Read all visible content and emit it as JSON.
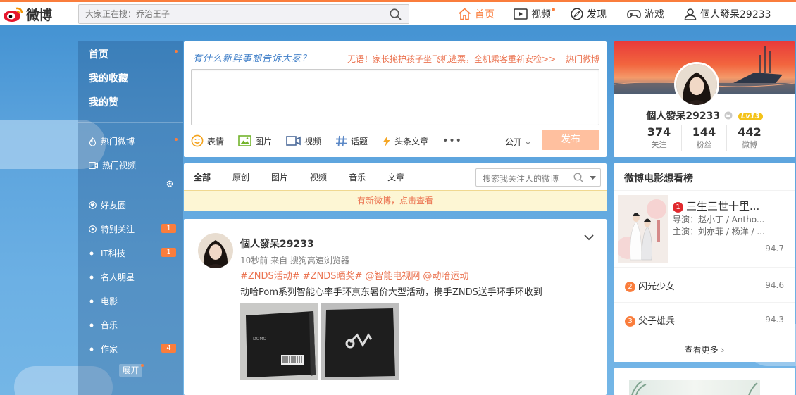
{
  "colors": {
    "accent": "#fa7d3c",
    "link": "#eb7350",
    "brand_blue": "#3e7ec8",
    "publish_disabled": "#ffc09f"
  },
  "header": {
    "logo_text": "微博",
    "search_placeholder": "大家正在搜：乔治王子",
    "nav": [
      {
        "label": "首页",
        "icon": "home-icon",
        "active": true
      },
      {
        "label": "视频",
        "icon": "video-icon",
        "dot": true
      },
      {
        "label": "发现",
        "icon": "compass-icon"
      },
      {
        "label": "游戏",
        "icon": "gamepad-icon"
      },
      {
        "label": "個人發呆29233",
        "icon": "user-icon"
      }
    ]
  },
  "sidebar": {
    "main": [
      "首页",
      "我的收藏",
      "我的赞"
    ],
    "hot": [
      {
        "label": "热门微博",
        "icon": "fire-icon"
      },
      {
        "label": "热门视频",
        "icon": "video-icon"
      }
    ],
    "groups": [
      {
        "label": "好友圈",
        "icon": "heart-icon"
      },
      {
        "label": "特别关注",
        "icon": "target-icon",
        "badge": "1"
      },
      {
        "label": "IT科技",
        "icon": "dot-icon",
        "badge": "1"
      },
      {
        "label": "名人明星",
        "icon": "dot-icon"
      },
      {
        "label": "电影",
        "icon": "dot-icon"
      },
      {
        "label": "音乐",
        "icon": "dot-icon"
      },
      {
        "label": "作家",
        "icon": "dot-icon",
        "badge": "4"
      }
    ],
    "expand_label": "展开"
  },
  "composer": {
    "prompt": "有什么新鲜事想告诉大家？",
    "hot_headline": "无语！家长掩护孩子坐飞机逃票，全机乘客重新安检>>",
    "hot_link": "热门微博",
    "tools": [
      "表情",
      "图片",
      "视频",
      "话题",
      "头条文章"
    ],
    "visibility": "公开",
    "publish": "发布"
  },
  "feed_filter": {
    "tabs": [
      "全部",
      "原创",
      "图片",
      "视频",
      "音乐",
      "文章"
    ],
    "search_placeholder": "搜索我关注人的微博",
    "new_notice": "有新微博，点击查看"
  },
  "post": {
    "author": "個人發呆29233",
    "meta": "10秒前 来自 搜狗高速浏览器",
    "tags": [
      "#ZNDS活动#",
      "#ZNDS晒奖#",
      "@智能电视网",
      "@动哈运动"
    ],
    "text": "动哈Pom系列智能心率手环京东暑价大型活动，携手ZNDS送手环手环收到"
  },
  "profile": {
    "name": "個人發呆29233",
    "level": "Lv13",
    "stats": [
      {
        "value": "374",
        "label": "关注"
      },
      {
        "value": "144",
        "label": "粉丝"
      },
      {
        "value": "442",
        "label": "微博"
      }
    ]
  },
  "movies": {
    "title": "微博电影想看榜",
    "items": [
      {
        "rank": "1",
        "name": "三生三世十里...",
        "director": "导演：赵小丁 / Antho...",
        "cast": "主演：刘亦菲 / 杨洋 / ...",
        "score": "94.7"
      },
      {
        "rank": "2",
        "name": "闪光少女",
        "score": "94.6"
      },
      {
        "rank": "3",
        "name": "父子雄兵",
        "score": "94.3"
      }
    ],
    "more": "查看更多"
  }
}
